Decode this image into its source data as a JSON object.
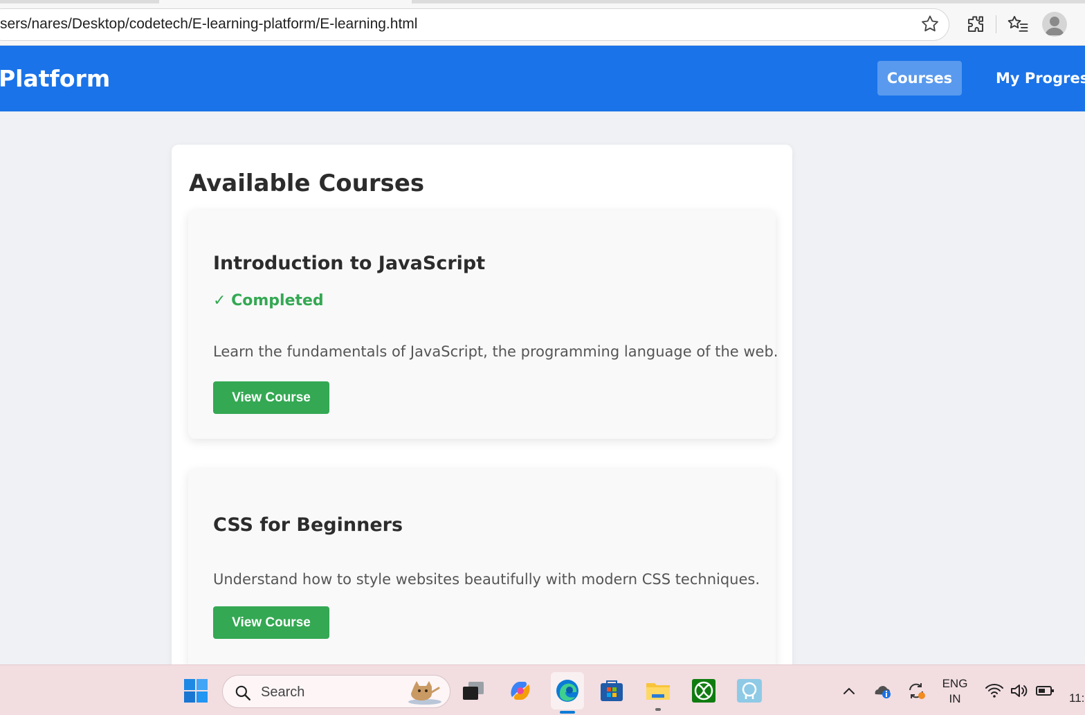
{
  "browser": {
    "url": "sers/nares/Desktop/codetech/E-learning-platform/E-learning.html"
  },
  "site": {
    "brand": "Platform",
    "nav": [
      {
        "label": "Courses",
        "active": true
      },
      {
        "label": "My Progress",
        "active": false
      }
    ],
    "accent_color": "#1a73e8"
  },
  "main": {
    "title": "Available Courses",
    "courses": [
      {
        "title": "Introduction to JavaScript",
        "status": "✓ Completed",
        "description": "Learn the fundamentals of JavaScript, the programming language of the web.",
        "button_label": "View Course"
      },
      {
        "title": "CSS for Beginners",
        "status": "",
        "description": "Understand how to style websites beautifully with modern CSS techniques.",
        "button_label": "View Course"
      }
    ],
    "button_color": "#34a853"
  },
  "taskbar": {
    "search_placeholder": "Search",
    "apps": [
      "task-view-icon",
      "copilot-icon",
      "edge-icon",
      "store-icon",
      "file-explorer-icon",
      "xbox-icon",
      "app-icon"
    ],
    "language_line1": "ENG",
    "language_line2": "IN",
    "clock": "11:"
  }
}
